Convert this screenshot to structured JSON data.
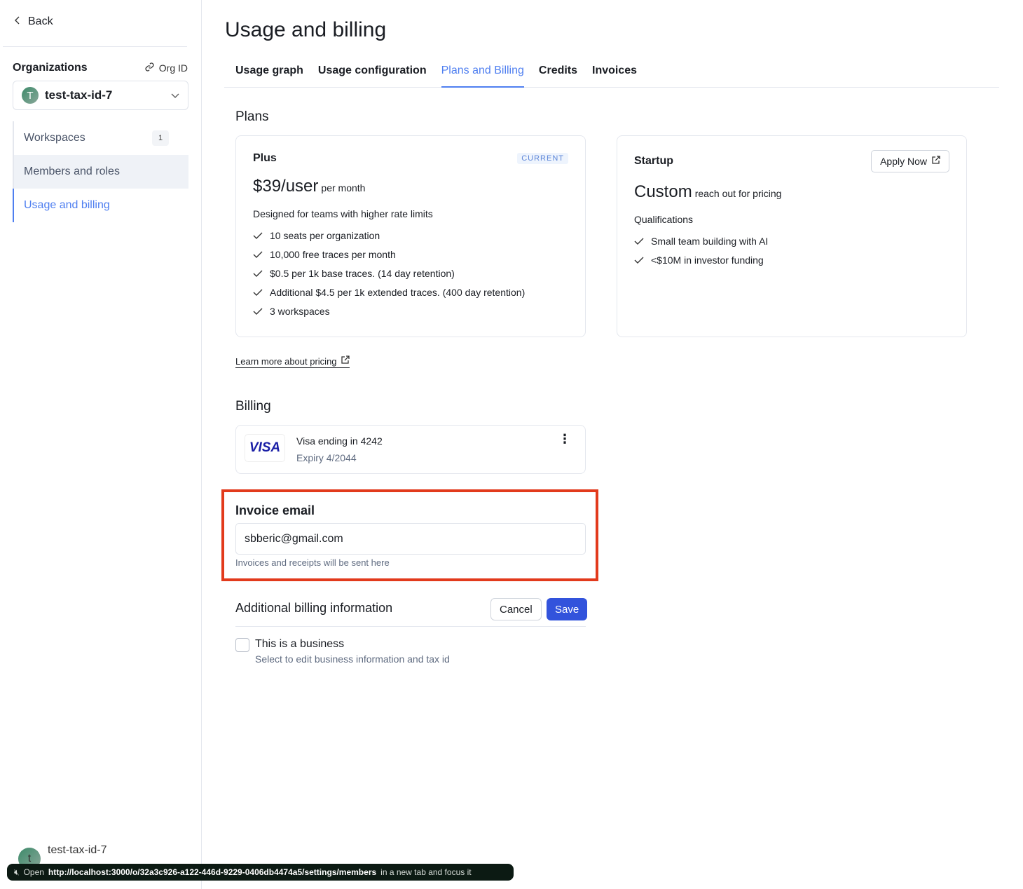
{
  "sidebar": {
    "back": "Back",
    "organizations_label": "Organizations",
    "org_id_label": "Org ID",
    "org_name": "test-tax-id-7",
    "org_initial": "T",
    "items": [
      {
        "label": "Workspaces",
        "badge": "1"
      },
      {
        "label": "Members and roles"
      },
      {
        "label": "Usage and billing"
      }
    ],
    "user": {
      "initial": "t",
      "name": "test-tax-id-7"
    }
  },
  "header": {
    "title": "Usage and billing"
  },
  "tabs": [
    {
      "label": "Usage graph"
    },
    {
      "label": "Usage configuration"
    },
    {
      "label": "Plans and Billing",
      "active": true
    },
    {
      "label": "Credits"
    },
    {
      "label": "Invoices"
    }
  ],
  "plans": {
    "title": "Plans",
    "plus": {
      "name": "Plus",
      "badge": "CURRENT",
      "price": "$39/user",
      "period": "per month",
      "description": "Designed for teams with higher rate limits",
      "features": [
        "10 seats per organization",
        "10,000 free traces per month",
        "$0.5 per 1k base traces. (14 day retention)",
        "Additional $4.5 per 1k extended traces. (400 day retention)",
        "3 workspaces"
      ]
    },
    "startup": {
      "name": "Startup",
      "apply": "Apply Now",
      "price": "Custom",
      "period": "reach out for pricing",
      "description": "Qualifications",
      "features": [
        "Small team building with AI",
        "<$10M in investor funding"
      ]
    },
    "learn_more": "Learn more about pricing"
  },
  "billing": {
    "title": "Billing",
    "card_brand": "VISA",
    "card_label": "Visa ending in 4242",
    "expiry": "Expiry 4/2044"
  },
  "invoice_email": {
    "title": "Invoice email",
    "value": "sbberic@gmail.com",
    "hint": "Invoices and receipts will be sent here"
  },
  "additional": {
    "title": "Additional billing information",
    "cancel": "Cancel",
    "save": "Save",
    "checkbox_label": "This is a business",
    "checkbox_hint": "Select to edit business information and tax id",
    "checked": false
  },
  "status_toast": {
    "prefix": "Open",
    "url": "http://localhost:3000/o/32a3c926-a122-446d-9229-0406db4474a5/settings/members",
    "suffix": "in a new tab and focus it"
  },
  "colors": {
    "accent": "#4f7ff0",
    "save": "#3253dc",
    "highlight": "#e23a1c"
  }
}
